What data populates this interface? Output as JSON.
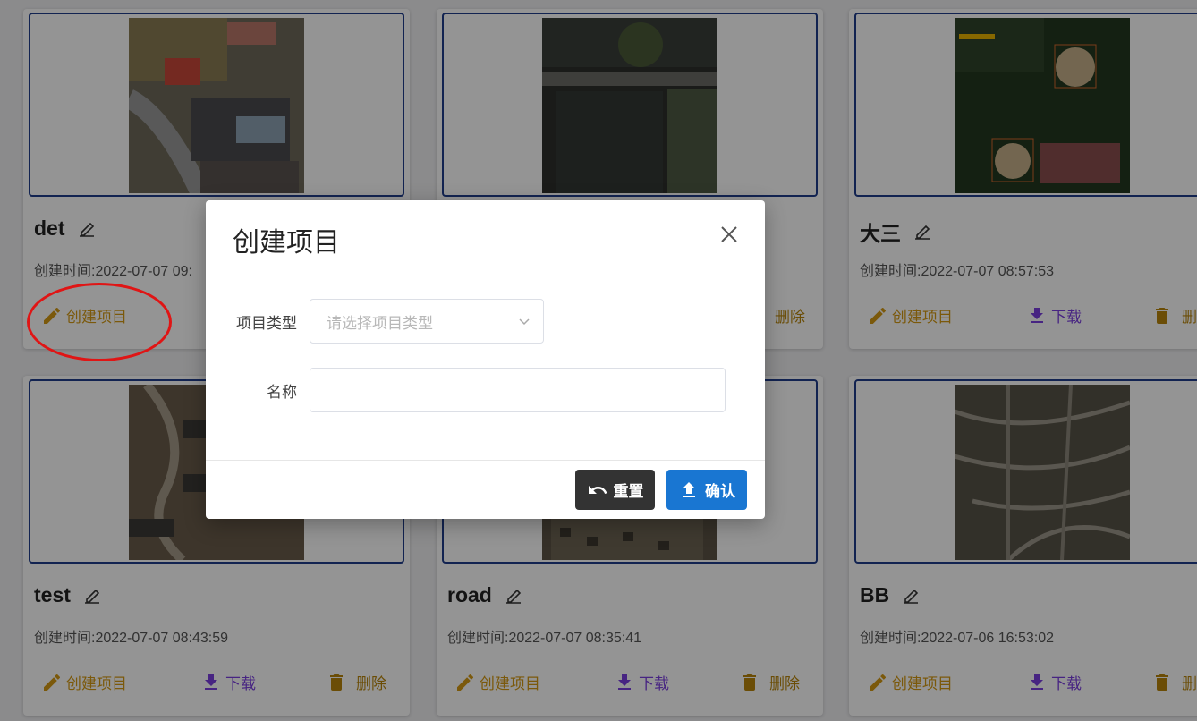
{
  "cards": [
    {
      "title": "det",
      "time": "创建时间:2022-07-07 09:",
      "img": "aerial-buildings"
    },
    {
      "title": "",
      "time": "",
      "img": "aerial-lake"
    },
    {
      "title": "大三",
      "time": "创建时间:2022-07-07 08:57:53",
      "img": "aerial-baseball"
    },
    {
      "title": "test",
      "time": "创建时间:2022-07-07 08:43:59",
      "img": "aerial-construction"
    },
    {
      "title": "road",
      "time": "创建时间:2022-07-07 08:35:41",
      "img": "aerial-town"
    },
    {
      "title": "BB",
      "time": "创建时间:2022-07-06 16:53:02",
      "img": "aerial-suburb"
    }
  ],
  "actions": {
    "create": "创建项目",
    "download": "下载",
    "delete": "删除"
  },
  "dialog": {
    "title": "创建项目",
    "type_label": "项目类型",
    "type_placeholder": "请选择项目类型",
    "name_label": "名称",
    "name_value": "",
    "reset_label": "重置",
    "confirm_label": "确认"
  },
  "colors": {
    "accent": "#1976d2",
    "create": "#d59a14",
    "download": "#7b3fe0",
    "annotation": "#e01515"
  }
}
